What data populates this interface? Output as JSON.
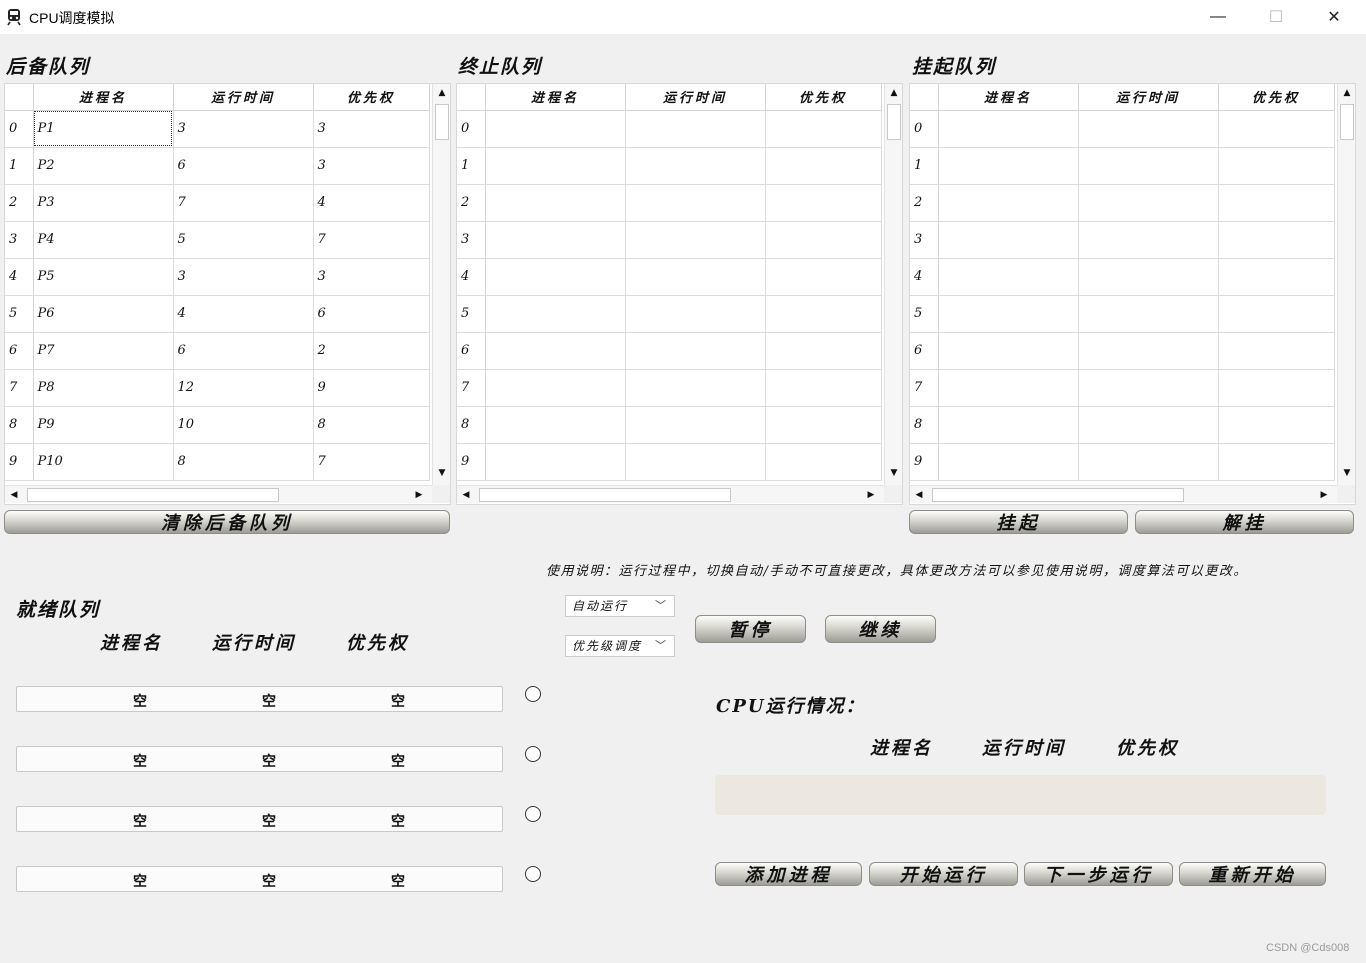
{
  "window": {
    "title": "CPU调度模拟",
    "icon": "train-icon"
  },
  "backup_queue": {
    "title": "后备队列",
    "columns": [
      "进程名",
      "运行时间",
      "优先权"
    ],
    "rows": [
      [
        "0",
        "P1",
        "3",
        "3"
      ],
      [
        "1",
        "P2",
        "6",
        "3"
      ],
      [
        "2",
        "P3",
        "7",
        "4"
      ],
      [
        "3",
        "P4",
        "5",
        "7"
      ],
      [
        "4",
        "P5",
        "3",
        "3"
      ],
      [
        "5",
        "P6",
        "4",
        "6"
      ],
      [
        "6",
        "P7",
        "6",
        "2"
      ],
      [
        "7",
        "P8",
        "12",
        "9"
      ],
      [
        "8",
        "P9",
        "10",
        "8"
      ],
      [
        "9",
        "P10",
        "8",
        "7"
      ]
    ],
    "clear_button": "清除后备队列"
  },
  "finished_queue": {
    "title": "终止队列",
    "columns": [
      "进程名",
      "运行时间",
      "优先权"
    ],
    "rows": [
      [
        "0",
        "",
        "",
        ""
      ],
      [
        "1",
        "",
        "",
        ""
      ],
      [
        "2",
        "",
        "",
        ""
      ],
      [
        "3",
        "",
        "",
        ""
      ],
      [
        "4",
        "",
        "",
        ""
      ],
      [
        "5",
        "",
        "",
        ""
      ],
      [
        "6",
        "",
        "",
        ""
      ],
      [
        "7",
        "",
        "",
        ""
      ],
      [
        "8",
        "",
        "",
        ""
      ],
      [
        "9",
        "",
        "",
        ""
      ]
    ]
  },
  "suspended_queue": {
    "title": "挂起队列",
    "columns": [
      "进程名",
      "运行时间",
      "优先权"
    ],
    "rows": [
      [
        "0",
        "",
        "",
        ""
      ],
      [
        "1",
        "",
        "",
        ""
      ],
      [
        "2",
        "",
        "",
        ""
      ],
      [
        "3",
        "",
        "",
        ""
      ],
      [
        "4",
        "",
        "",
        ""
      ],
      [
        "5",
        "",
        "",
        ""
      ],
      [
        "6",
        "",
        "",
        ""
      ],
      [
        "7",
        "",
        "",
        ""
      ],
      [
        "8",
        "",
        "",
        ""
      ],
      [
        "9",
        "",
        "",
        ""
      ]
    ],
    "suspend_button": "挂起",
    "resume_button": "解挂"
  },
  "instructions": "使用说明：运行过程中，切换自动/手动不可直接更改，具体更改方法可以参见使用说明，调度算法可以更改。",
  "ready_queue": {
    "title": "就绪队列",
    "headers": [
      "进程名",
      "运行时间",
      "优先权"
    ],
    "slots": [
      [
        "空",
        "空",
        "空"
      ],
      [
        "空",
        "空",
        "空"
      ],
      [
        "空",
        "空",
        "空"
      ],
      [
        "空",
        "空",
        "空"
      ]
    ]
  },
  "controls": {
    "mode_select": "自动运行",
    "algorithm_select": "优先级调度",
    "pause_button": "暂停",
    "continue_button": "继续"
  },
  "cpu": {
    "title": "CPU运行情况：",
    "headers": [
      "进程名",
      "运行时间",
      "优先权"
    ]
  },
  "actions": {
    "add_process": "添加进程",
    "start": "开始运行",
    "next_step": "下一步运行",
    "restart": "重新开始"
  },
  "watermark": "CSDN @Cds008"
}
